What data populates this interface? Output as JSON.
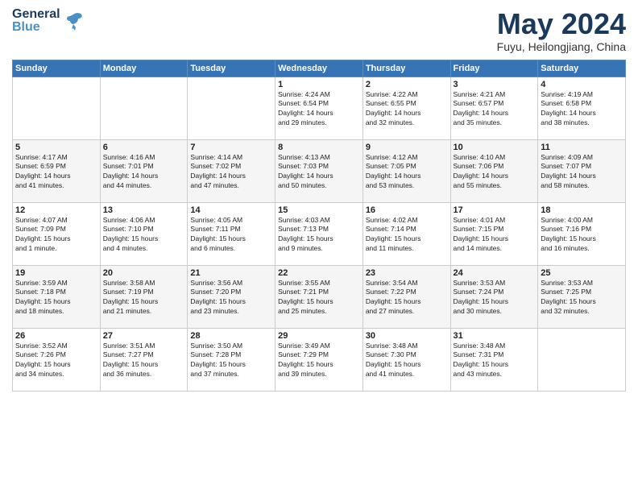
{
  "logo": {
    "general": "General",
    "blue": "Blue"
  },
  "header": {
    "month": "May 2024",
    "location": "Fuyu, Heilongjiang, China"
  },
  "days_of_week": [
    "Sunday",
    "Monday",
    "Tuesday",
    "Wednesday",
    "Thursday",
    "Friday",
    "Saturday"
  ],
  "weeks": [
    [
      {
        "day": "",
        "info": ""
      },
      {
        "day": "",
        "info": ""
      },
      {
        "day": "",
        "info": ""
      },
      {
        "day": "1",
        "info": "Sunrise: 4:24 AM\nSunset: 6:54 PM\nDaylight: 14 hours\nand 29 minutes."
      },
      {
        "day": "2",
        "info": "Sunrise: 4:22 AM\nSunset: 6:55 PM\nDaylight: 14 hours\nand 32 minutes."
      },
      {
        "day": "3",
        "info": "Sunrise: 4:21 AM\nSunset: 6:57 PM\nDaylight: 14 hours\nand 35 minutes."
      },
      {
        "day": "4",
        "info": "Sunrise: 4:19 AM\nSunset: 6:58 PM\nDaylight: 14 hours\nand 38 minutes."
      }
    ],
    [
      {
        "day": "5",
        "info": "Sunrise: 4:17 AM\nSunset: 6:59 PM\nDaylight: 14 hours\nand 41 minutes."
      },
      {
        "day": "6",
        "info": "Sunrise: 4:16 AM\nSunset: 7:01 PM\nDaylight: 14 hours\nand 44 minutes."
      },
      {
        "day": "7",
        "info": "Sunrise: 4:14 AM\nSunset: 7:02 PM\nDaylight: 14 hours\nand 47 minutes."
      },
      {
        "day": "8",
        "info": "Sunrise: 4:13 AM\nSunset: 7:03 PM\nDaylight: 14 hours\nand 50 minutes."
      },
      {
        "day": "9",
        "info": "Sunrise: 4:12 AM\nSunset: 7:05 PM\nDaylight: 14 hours\nand 53 minutes."
      },
      {
        "day": "10",
        "info": "Sunrise: 4:10 AM\nSunset: 7:06 PM\nDaylight: 14 hours\nand 55 minutes."
      },
      {
        "day": "11",
        "info": "Sunrise: 4:09 AM\nSunset: 7:07 PM\nDaylight: 14 hours\nand 58 minutes."
      }
    ],
    [
      {
        "day": "12",
        "info": "Sunrise: 4:07 AM\nSunset: 7:09 PM\nDaylight: 15 hours\nand 1 minute."
      },
      {
        "day": "13",
        "info": "Sunrise: 4:06 AM\nSunset: 7:10 PM\nDaylight: 15 hours\nand 4 minutes."
      },
      {
        "day": "14",
        "info": "Sunrise: 4:05 AM\nSunset: 7:11 PM\nDaylight: 15 hours\nand 6 minutes."
      },
      {
        "day": "15",
        "info": "Sunrise: 4:03 AM\nSunset: 7:13 PM\nDaylight: 15 hours\nand 9 minutes."
      },
      {
        "day": "16",
        "info": "Sunrise: 4:02 AM\nSunset: 7:14 PM\nDaylight: 15 hours\nand 11 minutes."
      },
      {
        "day": "17",
        "info": "Sunrise: 4:01 AM\nSunset: 7:15 PM\nDaylight: 15 hours\nand 14 minutes."
      },
      {
        "day": "18",
        "info": "Sunrise: 4:00 AM\nSunset: 7:16 PM\nDaylight: 15 hours\nand 16 minutes."
      }
    ],
    [
      {
        "day": "19",
        "info": "Sunrise: 3:59 AM\nSunset: 7:18 PM\nDaylight: 15 hours\nand 18 minutes."
      },
      {
        "day": "20",
        "info": "Sunrise: 3:58 AM\nSunset: 7:19 PM\nDaylight: 15 hours\nand 21 minutes."
      },
      {
        "day": "21",
        "info": "Sunrise: 3:56 AM\nSunset: 7:20 PM\nDaylight: 15 hours\nand 23 minutes."
      },
      {
        "day": "22",
        "info": "Sunrise: 3:55 AM\nSunset: 7:21 PM\nDaylight: 15 hours\nand 25 minutes."
      },
      {
        "day": "23",
        "info": "Sunrise: 3:54 AM\nSunset: 7:22 PM\nDaylight: 15 hours\nand 27 minutes."
      },
      {
        "day": "24",
        "info": "Sunrise: 3:53 AM\nSunset: 7:24 PM\nDaylight: 15 hours\nand 30 minutes."
      },
      {
        "day": "25",
        "info": "Sunrise: 3:53 AM\nSunset: 7:25 PM\nDaylight: 15 hours\nand 32 minutes."
      }
    ],
    [
      {
        "day": "26",
        "info": "Sunrise: 3:52 AM\nSunset: 7:26 PM\nDaylight: 15 hours\nand 34 minutes."
      },
      {
        "day": "27",
        "info": "Sunrise: 3:51 AM\nSunset: 7:27 PM\nDaylight: 15 hours\nand 36 minutes."
      },
      {
        "day": "28",
        "info": "Sunrise: 3:50 AM\nSunset: 7:28 PM\nDaylight: 15 hours\nand 37 minutes."
      },
      {
        "day": "29",
        "info": "Sunrise: 3:49 AM\nSunset: 7:29 PM\nDaylight: 15 hours\nand 39 minutes."
      },
      {
        "day": "30",
        "info": "Sunrise: 3:48 AM\nSunset: 7:30 PM\nDaylight: 15 hours\nand 41 minutes."
      },
      {
        "day": "31",
        "info": "Sunrise: 3:48 AM\nSunset: 7:31 PM\nDaylight: 15 hours\nand 43 minutes."
      },
      {
        "day": "",
        "info": ""
      }
    ]
  ]
}
